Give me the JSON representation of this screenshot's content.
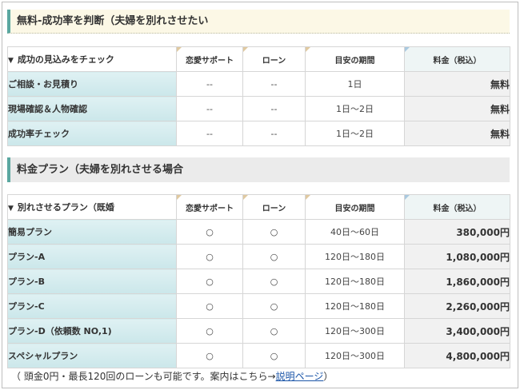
{
  "section1": {
    "title": "無料-成功率を判断（夫婦を別れさせたい",
    "header": {
      "corner": "成功の見込みをチェック",
      "cols": [
        "恋愛サポート",
        "ローン",
        "目安の期間"
      ],
      "fee": "料金（税込）"
    },
    "rows": [
      {
        "label": "ご相談・お見積り",
        "support": "--",
        "loan": "--",
        "period": "1日",
        "price": "無料"
      },
      {
        "label": "現場確認＆人物確認",
        "support": "--",
        "loan": "--",
        "period": "1日～2日",
        "price": "無料"
      },
      {
        "label": "成功率チェック",
        "support": "--",
        "loan": "--",
        "period": "1日～2日",
        "price": "無料"
      }
    ]
  },
  "section2": {
    "title": "料金プラン（夫婦を別れさせる場合",
    "header": {
      "corner": "別れさせるプラン（既婚",
      "cols": [
        "恋愛サポート",
        "ローン",
        "目安の期間"
      ],
      "fee": "料金（税込）"
    },
    "rows": [
      {
        "label": "簡易プラン",
        "support": "○",
        "loan": "○",
        "period": "40日～60日",
        "price": "380,000円"
      },
      {
        "label": "プラン-A",
        "support": "○",
        "loan": "○",
        "period": "120日～180日",
        "price": "1,080,000円"
      },
      {
        "label": "プラン-B",
        "support": "○",
        "loan": "○",
        "period": "120日～180日",
        "price": "1,860,000円"
      },
      {
        "label": "プラン-C",
        "support": "○",
        "loan": "○",
        "period": "120日～180日",
        "price": "2,260,000円"
      },
      {
        "label": "プラン-D（依頼数 NO,1)",
        "support": "○",
        "loan": "○",
        "period": "120日～300日",
        "price": "3,400,000円"
      },
      {
        "label": "スペシャルプラン",
        "support": "○",
        "loan": "○",
        "period": "120日～300日",
        "price": "4,800,000円"
      }
    ]
  },
  "footnote": {
    "text": "（ 頭金0円・最長120回のローンも可能です。案内はこちら→",
    "link": "説明ページ",
    "close": "）"
  },
  "colors": {
    "accent": "#5aa7a0",
    "label_bg": "#cbe7ea",
    "link": "#1b55a8"
  }
}
